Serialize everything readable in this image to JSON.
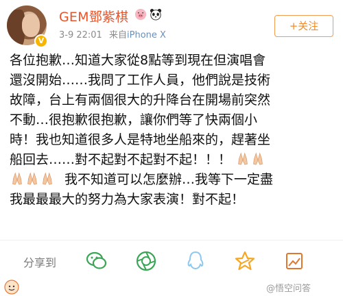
{
  "user": {
    "name": "GEM鄧紫棋",
    "verified_mark": "V",
    "emoji_1": "pig-emoji",
    "emoji_2": "panda-emoji"
  },
  "meta": {
    "time": "3-9 22:01",
    "source_prefix": "来自",
    "source_device": "iPhone X"
  },
  "follow_button": {
    "label": "+关注"
  },
  "post": {
    "lines": [
      "各位抱歉…知道大家從8點等到現在但演唱會",
      "還沒開始……我問了工作人員，他們說是技術",
      "故障，台上有兩個很大的升降台在開場前突然",
      "不動…很抱歉很抱歉，讓你們等了快兩個小",
      "時！我也知道很多人是特地坐船來的，趕著坐",
      "船回去……對不起對不起對不起！！！",
      "我不知道可以怎麼辦…我等下一定盡",
      "我最最最大的努力為大家表演！對不起！"
    ]
  },
  "share": {
    "label": "分享到",
    "targets": [
      "wechat-icon",
      "moments-icon",
      "qq-icon",
      "qzone-star-icon",
      "image-share-icon"
    ]
  },
  "footer": {
    "watermark": "@悟空问答"
  },
  "colors": {
    "name": "#e8542a",
    "follow": "#f08a2b",
    "share_icon": "#3aa655",
    "qq": "#8cc8ef",
    "star": "#f5a623"
  }
}
